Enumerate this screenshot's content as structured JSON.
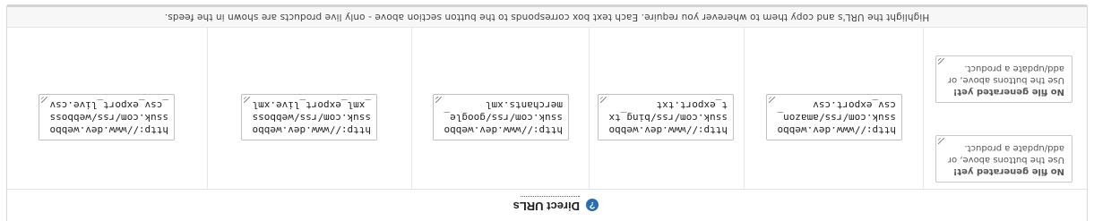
{
  "header": {
    "title": "Direct URLs",
    "help_glyph": "?"
  },
  "feeds": [
    {
      "url": "http://www.dev.webbossuk.com/rss/amazon_csv_export.csv"
    },
    {
      "url": "http://www.dev.webbossuk.com/rss/bing_txt_export.txt"
    },
    {
      "url": "http://www.dev.webbossuk.com/rss/google_merchants.xml"
    },
    {
      "url": "http://www.dev.webbossuk.com/rss/webboss_xml_export_live.xml"
    },
    {
      "url": "http://www.dev.webbossuk.com/rss/webboss_csv_export_live.csv"
    }
  ],
  "empty_message": {
    "bold": "No file generated yet!",
    "text": " Use the buttons above, or add/update a product."
  },
  "footer": {
    "note": "Highlight the URL's and copy them to wherever you require. Each text box corresponds to the button section above - only live products are shown in the feeds."
  },
  "colors": {
    "help_icon": "#2b6cb0",
    "border": "#d9d9d9",
    "footer_bg": "#f7f7f7"
  }
}
